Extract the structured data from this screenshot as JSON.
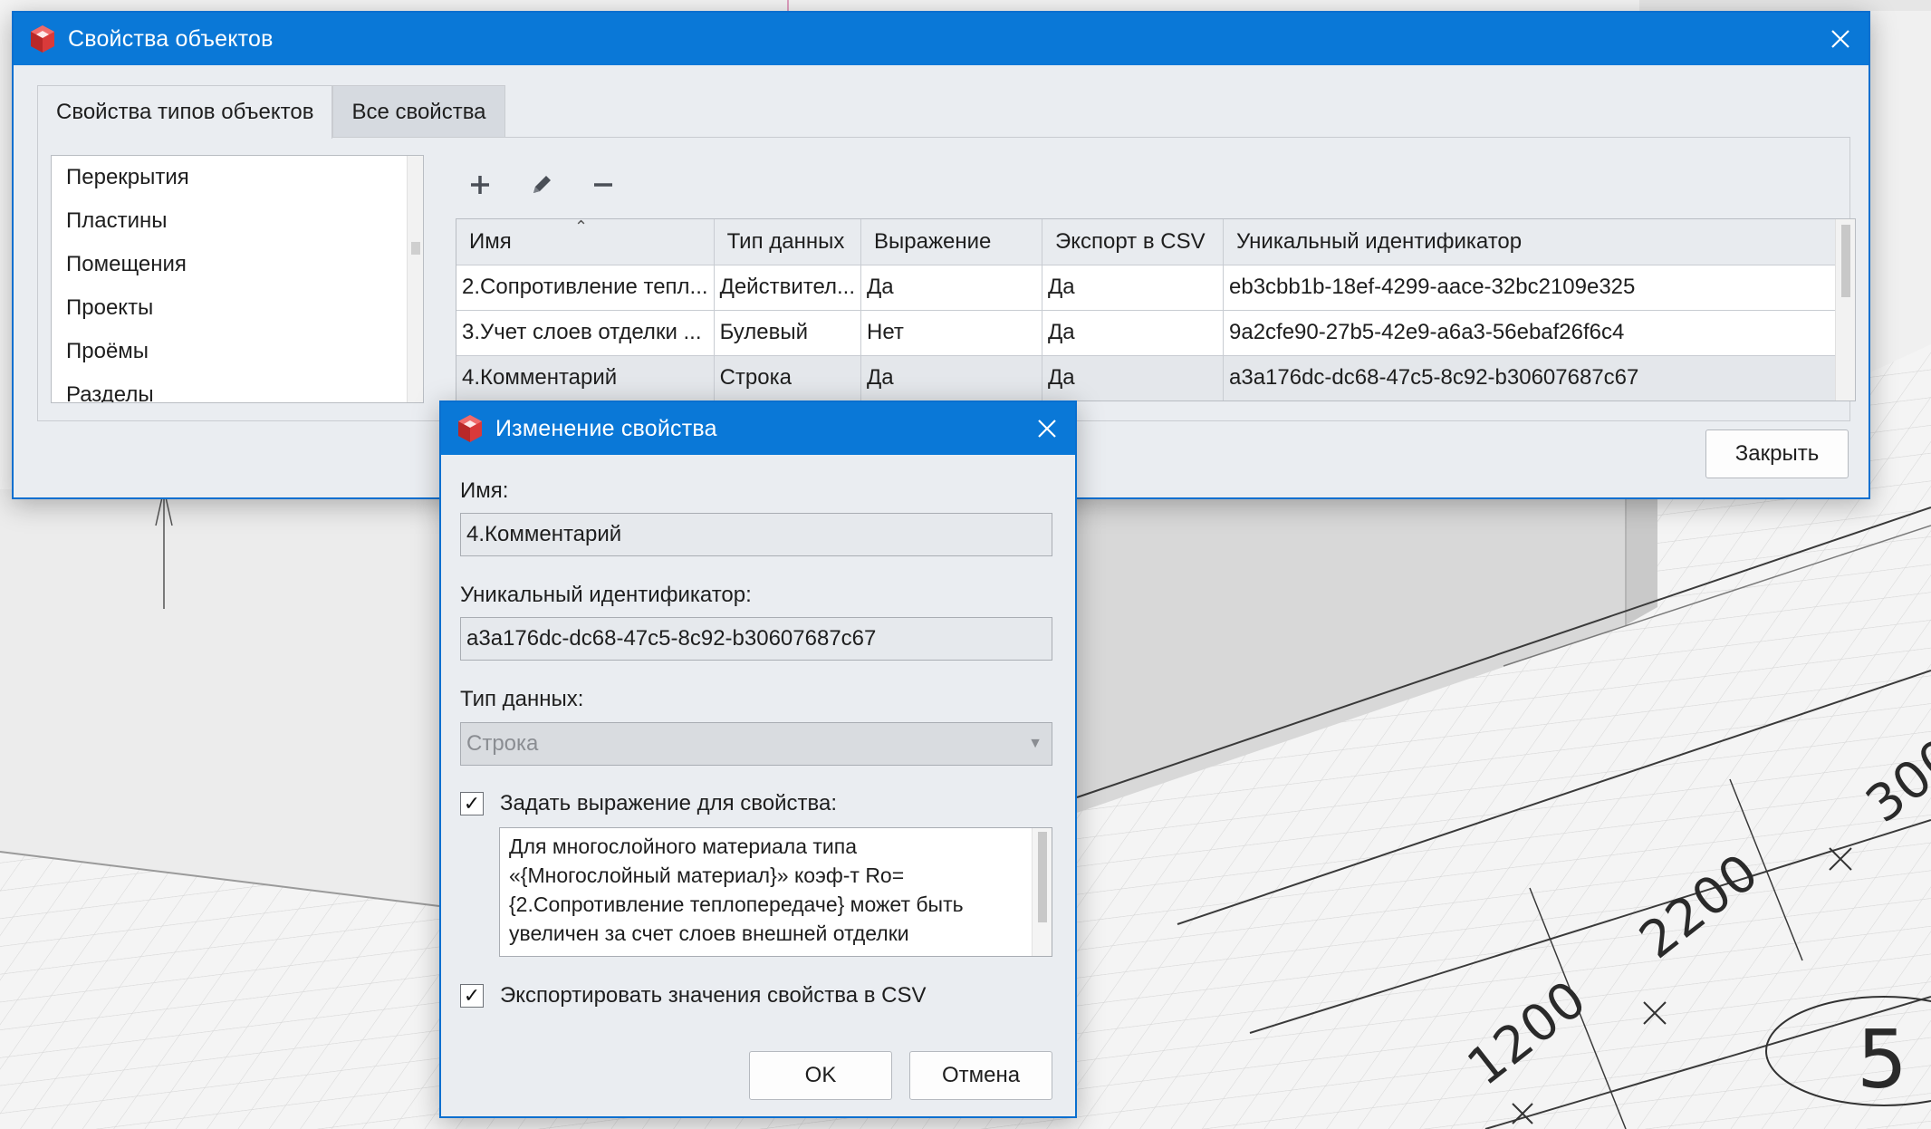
{
  "main_window": {
    "title": "Свойства объектов",
    "tabs": [
      {
        "label": "Свойства типов объектов",
        "active": true
      },
      {
        "label": "Все свойства",
        "active": false
      }
    ],
    "object_types": [
      "Перекрытия",
      "Пластины",
      "Помещения",
      "Проекты",
      "Проёмы",
      "Разделы"
    ],
    "toolbar": {
      "add_icon": "plus-icon",
      "edit_icon": "pencil-icon",
      "remove_icon": "minus-icon"
    },
    "table": {
      "columns": [
        "Имя",
        "Тип данных",
        "Выражение",
        "Экспорт в CSV",
        "Уникальный идентификатор"
      ],
      "rows": [
        {
          "name": "2.Сопротивление тепл...",
          "type": "Действител...",
          "expression": "Да",
          "export": "Да",
          "uid": "eb3cbb1b-18ef-4299-aace-32bc2109e325"
        },
        {
          "name": "3.Учет слоев отделки ...",
          "type": "Булевый",
          "expression": "Нет",
          "export": "Да",
          "uid": "9a2cfe90-27b5-42e9-a6a3-56ebaf26f6c4"
        },
        {
          "name": "4.Комментарий",
          "type": "Строка",
          "expression": "Да",
          "export": "Да",
          "uid": "a3a176dc-dc68-47c5-8c92-b30607687c67"
        }
      ]
    },
    "close_button": "Закрыть"
  },
  "edit_dialog": {
    "title": "Изменение свойства",
    "name_label": "Имя:",
    "name_value": "4.Комментарий",
    "uid_label": "Уникальный идентификатор:",
    "uid_value": "a3a176dc-dc68-47c5-8c92-b30607687c67",
    "type_label": "Тип данных:",
    "type_value": "Строка",
    "set_expression_label": "Задать выражение для свойства:",
    "set_expression_checked": true,
    "expression_text": "Для многослойного материала типа «{Многослойный материал}» коэф-т Ro={2.Сопротивление теплопередаче} может быть увеличен за счет слоев внешней отделки",
    "export_csv_label": "Экспортировать значения свойства в CSV",
    "export_csv_checked": true,
    "ok_button": "OK",
    "cancel_button": "Отмена"
  },
  "viewport": {
    "dimension_labels": [
      "1200",
      "2200",
      "300",
      "5"
    ]
  },
  "colors": {
    "title_bar": "#0a78d7",
    "window_bg": "#eaedf1",
    "app_icon": "#d93a3a"
  }
}
